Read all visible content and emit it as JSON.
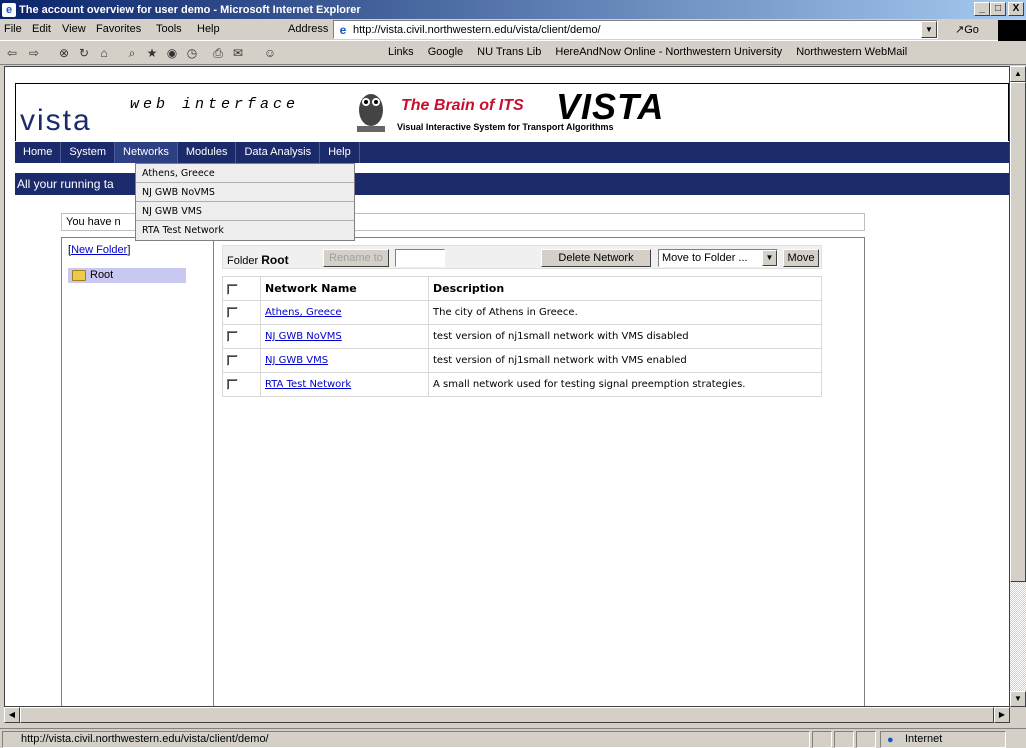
{
  "window": {
    "title": "The account overview for user demo - Microsoft Internet Explorer",
    "min": "_",
    "max": "□",
    "close": "X"
  },
  "menu": [
    "File",
    "Edit",
    "View",
    "Favorites",
    "Tools",
    "Help"
  ],
  "address": {
    "label": "Address",
    "url": "http://vista.civil.northwestern.edu/vista/client/demo/",
    "go": "Go"
  },
  "links": {
    "label": "Links",
    "items": [
      "Google",
      "NU Trans Lib",
      "HereAndNow Online - Northwestern University",
      "Northwestern WebMail"
    ]
  },
  "header": {
    "logo": "vista",
    "subtitle": "web interface",
    "brain": "The Brain of ITS",
    "vista_big": "VISTA",
    "tagline": "Visual Interactive System for Transport Algorithms"
  },
  "nav": [
    "Home",
    "System",
    "Networks",
    "Modules",
    "Data Analysis",
    "Help"
  ],
  "dropdown": [
    "Athens, Greece",
    "NJ GWB NoVMS",
    "NJ GWB VMS",
    "RTA Test Network"
  ],
  "running_tasks": "All your running ta",
  "message": "You have n",
  "left": {
    "new_folder": "New Folder",
    "root": "Root"
  },
  "folder": {
    "label": "Folder",
    "name": "Root",
    "rename": "Rename to",
    "delete": "Delete Network",
    "move_select": "Move to Folder ...",
    "move": "Move"
  },
  "table": {
    "headers": [
      "Network Name",
      "Description"
    ],
    "rows": [
      {
        "name": "Athens, Greece",
        "desc": "The city of Athens in Greece."
      },
      {
        "name": "NJ GWB NoVMS",
        "desc": "test version of nj1small network with VMS disabled"
      },
      {
        "name": "NJ GWB VMS",
        "desc": "test version of nj1small network with VMS enabled"
      },
      {
        "name": "RTA Test Network",
        "desc": "A small network used for testing signal preemption strategies."
      }
    ]
  },
  "status": {
    "url": "http://vista.civil.northwestern.edu/vista/client/demo/",
    "zone": "Internet"
  }
}
